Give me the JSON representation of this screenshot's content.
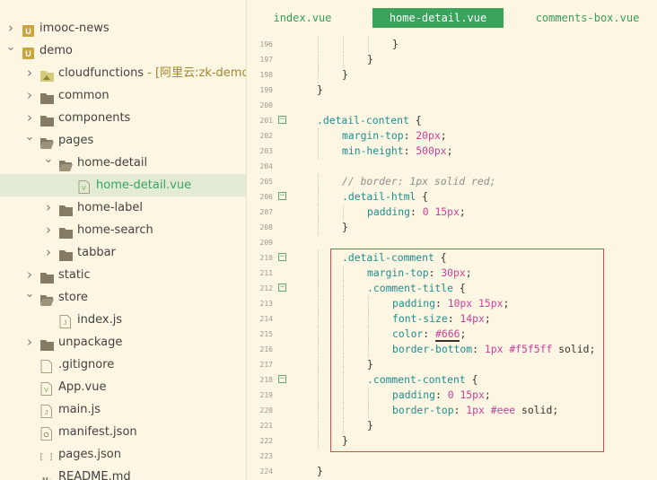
{
  "sidebar": {
    "items": [
      {
        "label": "imooc-news",
        "suffix": "",
        "icon": "project-icon",
        "arrow": "right",
        "depth": 0,
        "selected": false
      },
      {
        "label": "demo",
        "suffix": "",
        "icon": "project-icon",
        "arrow": "down",
        "depth": 0,
        "selected": false
      },
      {
        "label": "cloudfunctions",
        "suffix": " - [阿里云:zk-demo]",
        "icon": "cloud-folder-icon",
        "arrow": "right",
        "depth": 1,
        "selected": false
      },
      {
        "label": "common",
        "suffix": "",
        "icon": "folder-icon",
        "arrow": "right",
        "depth": 1,
        "selected": false
      },
      {
        "label": "components",
        "suffix": "",
        "icon": "folder-icon",
        "arrow": "right",
        "depth": 1,
        "selected": false
      },
      {
        "label": "pages",
        "suffix": "",
        "icon": "folder-open-icon",
        "arrow": "down",
        "depth": 1,
        "selected": false
      },
      {
        "label": "home-detail",
        "suffix": "",
        "icon": "folder-open-icon",
        "arrow": "down",
        "depth": 2,
        "selected": false
      },
      {
        "label": "home-detail.vue",
        "suffix": "",
        "icon": "vue-file-icon",
        "arrow": "",
        "depth": 3,
        "selected": true
      },
      {
        "label": "home-label",
        "suffix": "",
        "icon": "folder-icon",
        "arrow": "right",
        "depth": 2,
        "selected": false
      },
      {
        "label": "home-search",
        "suffix": "",
        "icon": "folder-icon",
        "arrow": "right",
        "depth": 2,
        "selected": false
      },
      {
        "label": "tabbar",
        "suffix": "",
        "icon": "folder-icon",
        "arrow": "right",
        "depth": 2,
        "selected": false
      },
      {
        "label": "static",
        "suffix": "",
        "icon": "folder-icon",
        "arrow": "right",
        "depth": 1,
        "selected": false
      },
      {
        "label": "store",
        "suffix": "",
        "icon": "folder-open-icon",
        "arrow": "down",
        "depth": 1,
        "selected": false
      },
      {
        "label": "index.js",
        "suffix": "",
        "icon": "js-file-icon",
        "arrow": "",
        "depth": 2,
        "selected": false
      },
      {
        "label": "unpackage",
        "suffix": "",
        "icon": "folder-icon",
        "arrow": "right",
        "depth": 1,
        "selected": false
      },
      {
        "label": ".gitignore",
        "suffix": "",
        "icon": "file-icon",
        "arrow": "",
        "depth": 1,
        "selected": false
      },
      {
        "label": "App.vue",
        "suffix": "",
        "icon": "vue-file-icon",
        "arrow": "",
        "depth": 1,
        "selected": false
      },
      {
        "label": "main.js",
        "suffix": "",
        "icon": "js-file-icon",
        "arrow": "",
        "depth": 1,
        "selected": false
      },
      {
        "label": "manifest.json",
        "suffix": "",
        "icon": "config-file-icon",
        "arrow": "",
        "depth": 1,
        "selected": false
      },
      {
        "label": "pages.json",
        "suffix": "",
        "icon": "json-file-icon",
        "arrow": "",
        "depth": 1,
        "selected": false
      },
      {
        "label": "README.md",
        "suffix": "",
        "icon": "md-file-icon",
        "arrow": "",
        "depth": 1,
        "selected": false
      }
    ]
  },
  "tabs": [
    {
      "label": "index.vue",
      "active": false
    },
    {
      "label": "home-detail.vue",
      "active": true
    },
    {
      "label": "comments-box.vue",
      "active": false
    }
  ],
  "editor": {
    "lines": [
      {
        "num": "196",
        "fold": false,
        "indent": 4,
        "tokens": [
          [
            "punct",
            "}"
          ]
        ]
      },
      {
        "num": "197",
        "fold": false,
        "indent": 3,
        "tokens": [
          [
            "punct",
            "}"
          ]
        ]
      },
      {
        "num": "198",
        "fold": false,
        "indent": 2,
        "tokens": [
          [
            "punct",
            "}"
          ]
        ]
      },
      {
        "num": "199",
        "fold": false,
        "indent": 1,
        "tokens": [
          [
            "punct",
            "}"
          ]
        ]
      },
      {
        "num": "200",
        "fold": false,
        "indent": 0,
        "tokens": []
      },
      {
        "num": "201",
        "fold": true,
        "indent": 1,
        "tokens": [
          [
            "sel",
            ".detail-content"
          ],
          [
            "punct",
            " {"
          ]
        ]
      },
      {
        "num": "202",
        "fold": false,
        "indent": 2,
        "tokens": [
          [
            "prop",
            "margin-top"
          ],
          [
            "punct",
            ": "
          ],
          [
            "num",
            "20"
          ],
          [
            "unit",
            "px"
          ],
          [
            "punct",
            ";"
          ]
        ]
      },
      {
        "num": "203",
        "fold": false,
        "indent": 2,
        "tokens": [
          [
            "prop",
            "min-height"
          ],
          [
            "punct",
            ": "
          ],
          [
            "num",
            "500"
          ],
          [
            "unit",
            "px"
          ],
          [
            "punct",
            ";"
          ]
        ]
      },
      {
        "num": "204",
        "fold": false,
        "indent": 0,
        "tokens": []
      },
      {
        "num": "205",
        "fold": false,
        "indent": 2,
        "tokens": [
          [
            "comment",
            "// border: 1px solid red;"
          ]
        ]
      },
      {
        "num": "206",
        "fold": true,
        "indent": 2,
        "tokens": [
          [
            "sel",
            ".detail-html"
          ],
          [
            "punct",
            " {"
          ]
        ]
      },
      {
        "num": "207",
        "fold": false,
        "indent": 3,
        "tokens": [
          [
            "prop",
            "padding"
          ],
          [
            "punct",
            ": "
          ],
          [
            "num",
            "0 15"
          ],
          [
            "unit",
            "px"
          ],
          [
            "punct",
            ";"
          ]
        ]
      },
      {
        "num": "208",
        "fold": false,
        "indent": 2,
        "tokens": [
          [
            "punct",
            "}"
          ]
        ]
      },
      {
        "num": "209",
        "fold": false,
        "indent": 0,
        "tokens": []
      },
      {
        "num": "210",
        "fold": true,
        "indent": 2,
        "tokens": [
          [
            "sel",
            ".detail-comment"
          ],
          [
            "punct",
            " {"
          ]
        ]
      },
      {
        "num": "211",
        "fold": false,
        "indent": 3,
        "tokens": [
          [
            "prop",
            "margin-top"
          ],
          [
            "punct",
            ": "
          ],
          [
            "num",
            "30"
          ],
          [
            "unit",
            "px"
          ],
          [
            "punct",
            ";"
          ]
        ]
      },
      {
        "num": "212",
        "fold": true,
        "indent": 3,
        "tokens": [
          [
            "sel",
            ".comment-title"
          ],
          [
            "punct",
            " {"
          ]
        ]
      },
      {
        "num": "213",
        "fold": false,
        "indent": 4,
        "tokens": [
          [
            "prop",
            "padding"
          ],
          [
            "punct",
            ": "
          ],
          [
            "num",
            "10"
          ],
          [
            "unit",
            "px "
          ],
          [
            "num",
            "15"
          ],
          [
            "unit",
            "px"
          ],
          [
            "punct",
            ";"
          ]
        ]
      },
      {
        "num": "214",
        "fold": false,
        "indent": 4,
        "tokens": [
          [
            "prop",
            "font-size"
          ],
          [
            "punct",
            ": "
          ],
          [
            "num",
            "14"
          ],
          [
            "unit",
            "px"
          ],
          [
            "punct",
            ";"
          ]
        ]
      },
      {
        "num": "215",
        "fold": false,
        "indent": 4,
        "tokens": [
          [
            "prop",
            "color"
          ],
          [
            "punct",
            ": "
          ],
          [
            "hexul",
            "#666"
          ],
          [
            "punct",
            ";"
          ]
        ]
      },
      {
        "num": "216",
        "fold": false,
        "indent": 4,
        "tokens": [
          [
            "prop",
            "border-bottom"
          ],
          [
            "punct",
            ": "
          ],
          [
            "num",
            "1"
          ],
          [
            "unit",
            "px "
          ],
          [
            "hex",
            "#f5f5ff"
          ],
          [
            "val",
            " solid"
          ],
          [
            "punct",
            ";"
          ]
        ]
      },
      {
        "num": "217",
        "fold": false,
        "indent": 3,
        "tokens": [
          [
            "punct",
            "}"
          ]
        ]
      },
      {
        "num": "218",
        "fold": true,
        "indent": 3,
        "tokens": [
          [
            "sel",
            ".comment-content"
          ],
          [
            "punct",
            " {"
          ]
        ]
      },
      {
        "num": "219",
        "fold": false,
        "indent": 4,
        "tokens": [
          [
            "prop",
            "padding"
          ],
          [
            "punct",
            ": "
          ],
          [
            "num",
            "0 15"
          ],
          [
            "unit",
            "px"
          ],
          [
            "punct",
            ";"
          ]
        ]
      },
      {
        "num": "220",
        "fold": false,
        "indent": 4,
        "tokens": [
          [
            "prop",
            "border-top"
          ],
          [
            "punct",
            ": "
          ],
          [
            "num",
            "1"
          ],
          [
            "unit",
            "px "
          ],
          [
            "hex",
            "#eee"
          ],
          [
            "val",
            " solid"
          ],
          [
            "punct",
            ";"
          ]
        ]
      },
      {
        "num": "221",
        "fold": false,
        "indent": 3,
        "tokens": [
          [
            "punct",
            "}"
          ]
        ]
      },
      {
        "num": "222",
        "fold": false,
        "indent": 2,
        "tokens": [
          [
            "punct",
            "}"
          ]
        ]
      },
      {
        "num": "223",
        "fold": false,
        "indent": 0,
        "tokens": []
      },
      {
        "num": "224",
        "fold": false,
        "indent": 1,
        "tokens": [
          [
            "punct",
            "}"
          ]
        ]
      }
    ]
  },
  "colors": {
    "accent": "#3aa45c",
    "background": "#fdf6e3",
    "highlight_box": "#d94a4a"
  }
}
